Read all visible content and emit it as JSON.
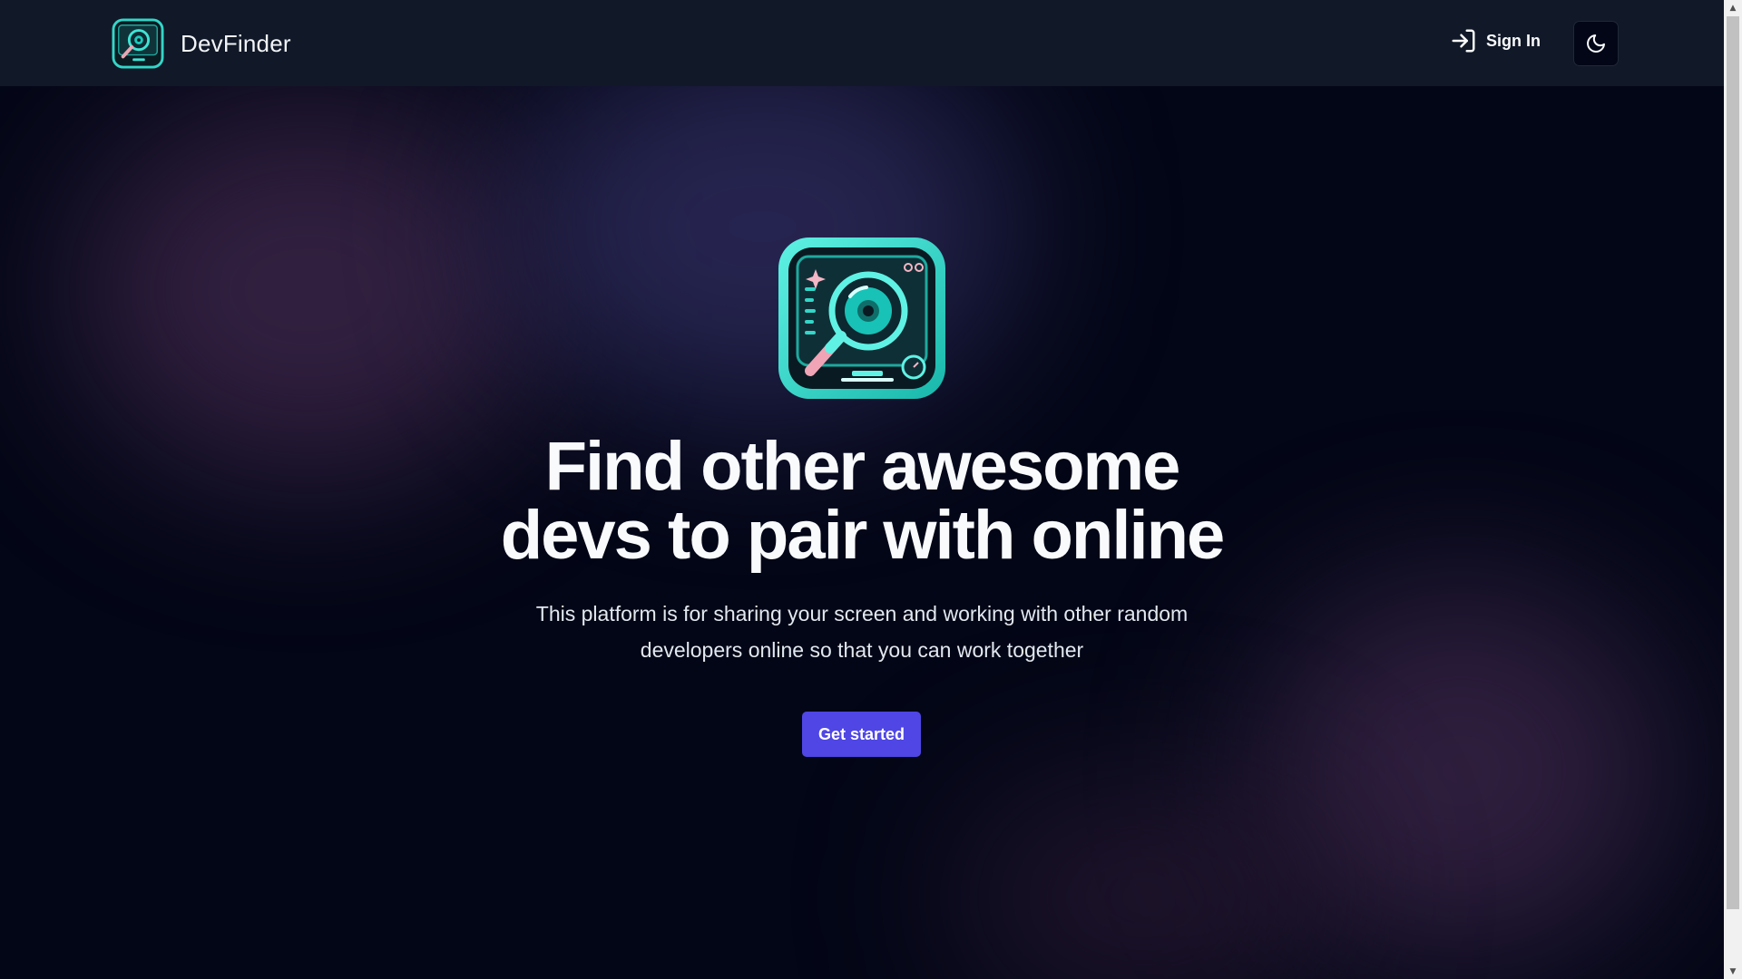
{
  "header": {
    "brand_name": "DevFinder",
    "brand_icon": "devfinder-logo",
    "signin_label": "Sign In",
    "signin_icon": "log-in-icon",
    "theme_icon": "moon-icon"
  },
  "hero": {
    "logo_icon": "devfinder-logo",
    "headline_line1": "Find other awesome",
    "headline_line2": "devs to pair with online",
    "subtitle_line1": "This platform is for sharing your screen and working with other random",
    "subtitle_line2": "developers online so that you can work together",
    "cta_label": "Get started"
  },
  "colors": {
    "background": "#030616",
    "header": "#111827",
    "accent": "#4f46e5",
    "logo_teal": "#14d4c8"
  }
}
